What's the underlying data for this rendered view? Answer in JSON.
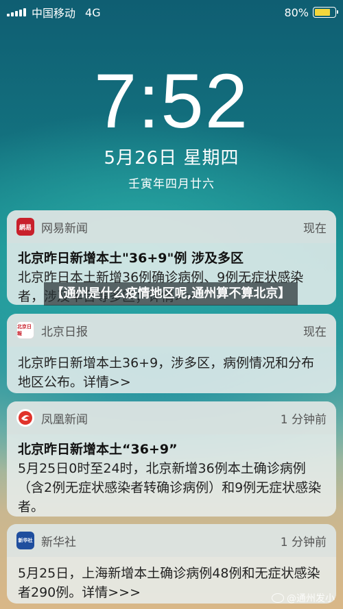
{
  "status_bar": {
    "carrier": "中国移动",
    "network": "4G",
    "battery": "80%",
    "battery_level": 0.8
  },
  "lockscreen": {
    "time": "7:52",
    "date": "5月26日 星期四",
    "lunar_date": "壬寅年四月廿六"
  },
  "notifications": [
    {
      "app": "网易新闻",
      "time": "现在",
      "title": "北京昨日新增本土\"36+9\"例 涉及多区",
      "text": "北京昨日本土新增36例确诊病例、9例无症状感染者，涉及丰台等多区；详情>>",
      "icon_text": "網易",
      "icon_color": "#c8202b"
    },
    {
      "app": "北京日报",
      "time": "现在",
      "title": "",
      "text": "北京昨日新增本土36+9，涉多区，病例情况和分布地区公布。详情>>",
      "icon_text": "北京日報",
      "icon_color": "#ffffff"
    },
    {
      "app": "凤凰新闻",
      "time": "1 分钟前",
      "title": "北京昨日新增本土“36+9”",
      "text": "5月25日0时至24时，北京新增36例本土确诊病例（含2例无症状感染者转确诊病例）和9例无症状感染者。",
      "icon_text": "",
      "icon_color": "#e0332b"
    },
    {
      "app": "新华社",
      "time": "1 分钟前",
      "title": "",
      "text": "5月25日，上海新增本土确诊病例48例和无症状感染者290例。详情>>>",
      "icon_text": "新华社",
      "icon_color": "#1f4e9e"
    }
  ],
  "overlay_title": "【通州是什么疫情地区呢,通州算不算北京】",
  "watermark": "@通州发小"
}
